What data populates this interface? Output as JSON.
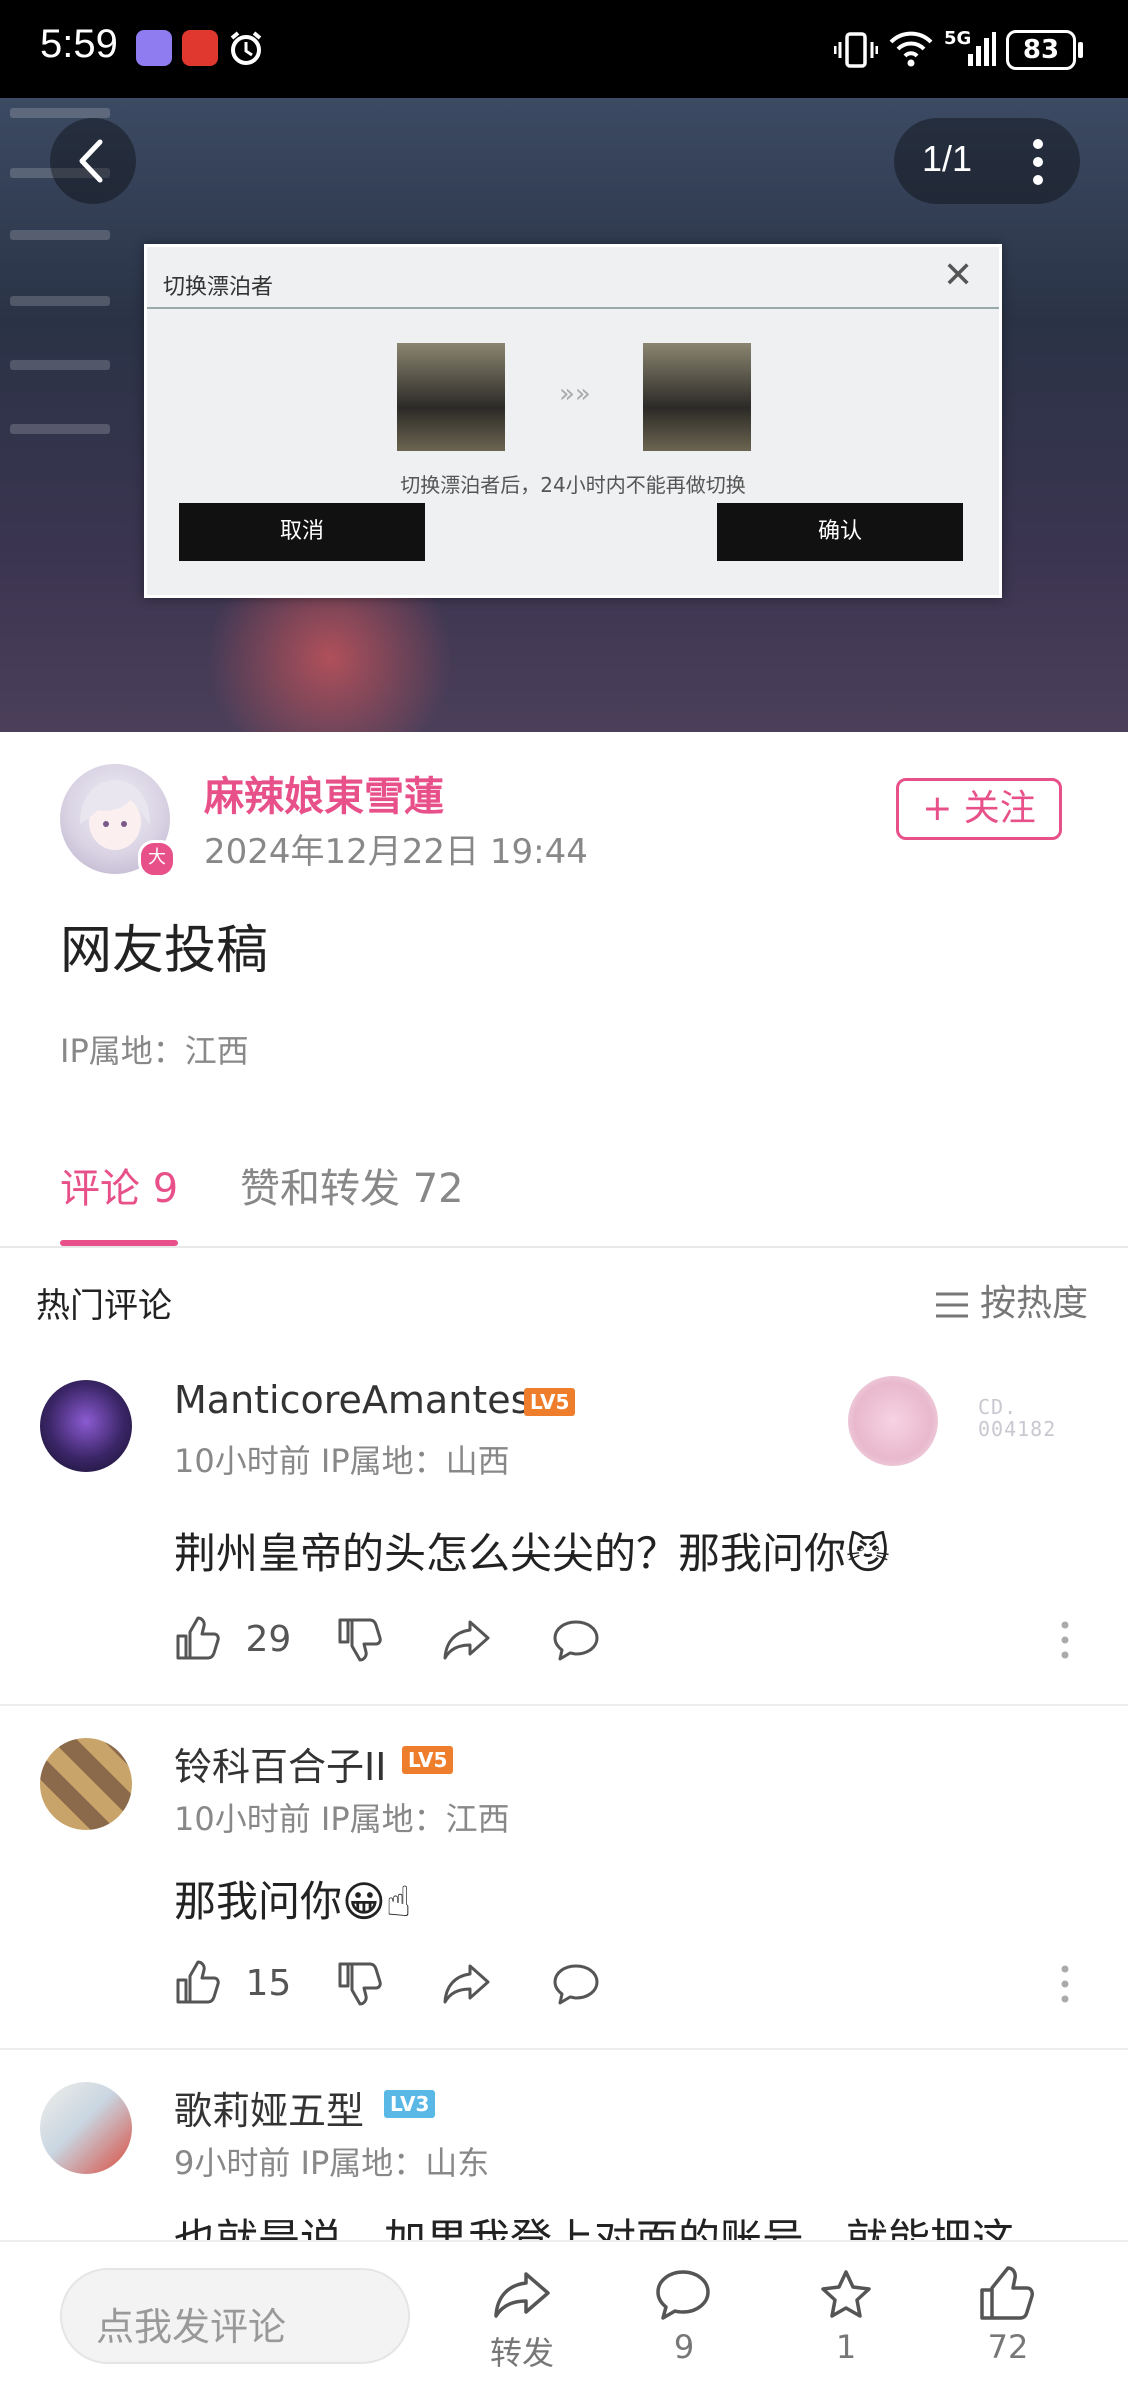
{
  "status_bar": {
    "time": "5:59",
    "network": "5G",
    "battery": "83"
  },
  "viewer": {
    "counter": "1/1"
  },
  "hero_image": {
    "dialog_title": "切换漂泊者",
    "dialog_note": "切换漂泊者后，24小时内不能再做切换",
    "cancel_label": "取消",
    "confirm_label": "确认"
  },
  "post": {
    "author": "麻辣娘東雪蓮",
    "author_badge": "大",
    "time": "2024年12月22日 19:44",
    "follow_label": "+ 关注",
    "title": "网友投稿",
    "ip": "IP属地：江西"
  },
  "tabs": [
    {
      "label": "评论 9"
    },
    {
      "label": "赞和转发 72"
    }
  ],
  "comments_section": {
    "title": "热门评论",
    "sort_label": "按热度"
  },
  "comments": [
    {
      "name": "ManticoreAmantes",
      "level": "LV5",
      "level_color": "#ee7d2c",
      "meta": "10小时前 IP属地：山西",
      "text": "荆州皇帝的头怎么尖尖的？那我问你",
      "emoji": "😼",
      "decoration_code": "CD. 004182",
      "likes": "29"
    },
    {
      "name": "铃科百合子II",
      "level": "LV5",
      "level_color": "#ee7d2c",
      "meta": "10小时前 IP属地：江西",
      "text": "那我问你",
      "emoji": "😀☝",
      "likes": "15"
    },
    {
      "name": "歌莉娅五型",
      "level": "LV3",
      "level_color": "#59b8e6",
      "meta": "9小时前 IP属地：山东",
      "text": "也就是说，加果我登上对面的账号，就能把这"
    }
  ],
  "bottom_bar": {
    "input_placeholder": "点我发评论",
    "repost_label": "转发",
    "comment_count": "9",
    "favorite_count": "1",
    "like_count": "72"
  },
  "colors": {
    "accent": "#e8508a",
    "lv5": "#ee7d2c",
    "lv3": "#59b8e6"
  }
}
